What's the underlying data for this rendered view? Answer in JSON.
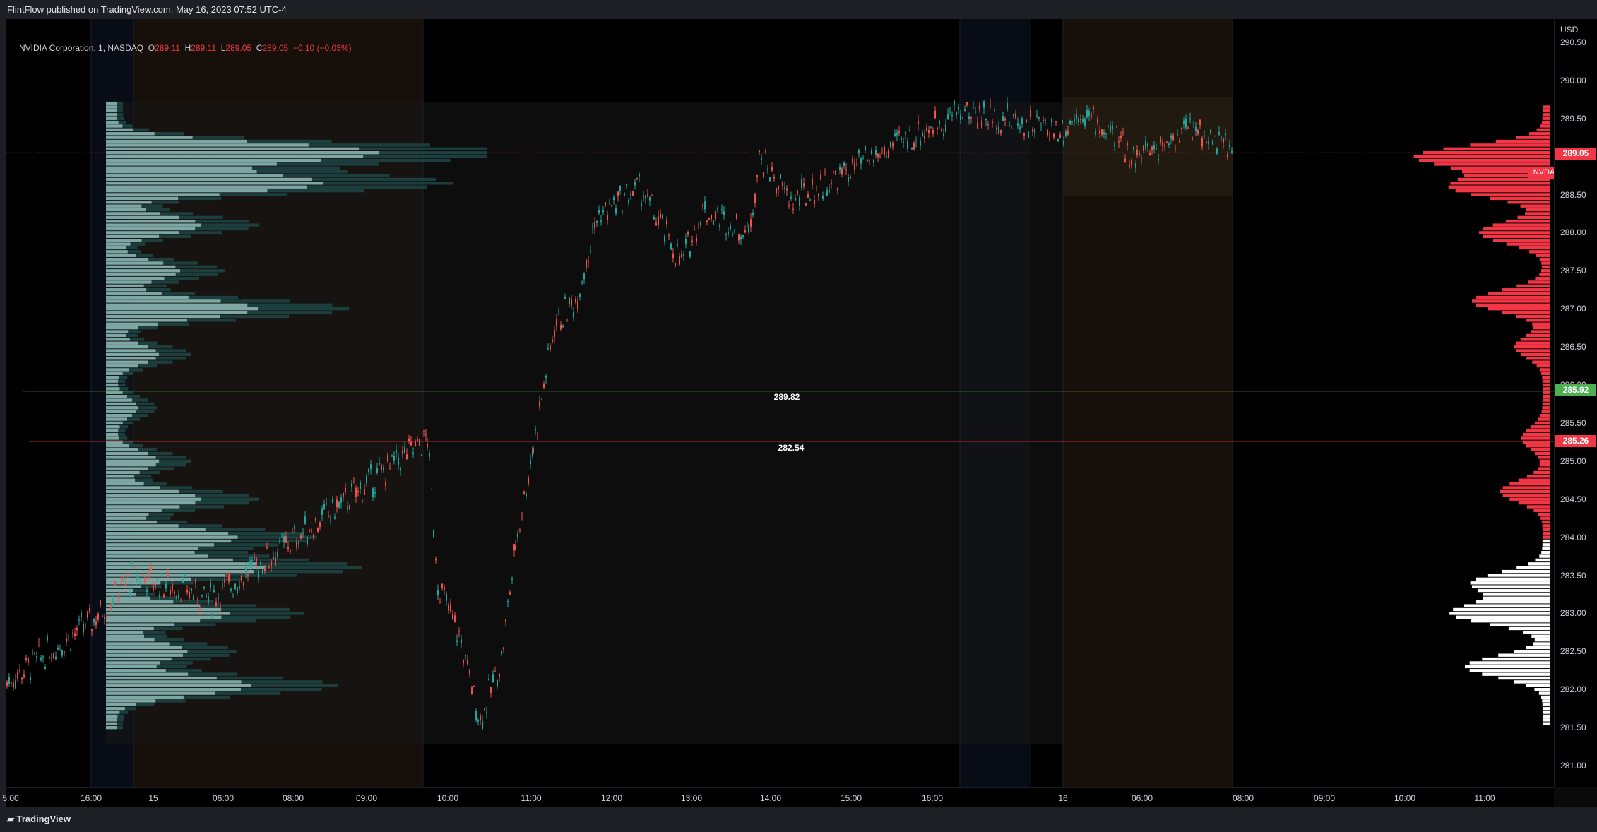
{
  "header": {
    "published": "FlintFlow published on TradingView.com, May 16, 2023 07:52 UTC-4"
  },
  "legend": {
    "symbol": "NVIDIA Corporation, 1, NASDAQ",
    "o_label": "O",
    "o": "289.11",
    "h_label": "H",
    "h": "289.11",
    "l_label": "L",
    "l": "289.05",
    "c_label": "C",
    "c": "289.05",
    "change": "−0.10 (−0.03%)"
  },
  "price_axis": {
    "currency": "USD",
    "ticks": [
      "290.50",
      "290.00",
      "289.50",
      "289.00",
      "288.50",
      "288.00",
      "287.50",
      "287.00",
      "286.50",
      "286.00",
      "285.50",
      "285.00",
      "284.50",
      "284.00",
      "283.50",
      "283.00",
      "282.50",
      "282.00",
      "281.50",
      "281.00"
    ],
    "last_price": "289.05",
    "last_symbol": "NVDA",
    "level_green": "285.92",
    "level_red": "285.26"
  },
  "time_axis": {
    "ticks": [
      "5:00",
      "16:00",
      "15",
      "06:00",
      "08:00",
      "09:00",
      "10:00",
      "11:00",
      "12:00",
      "13:00",
      "14:00",
      "15:00",
      "16:00",
      "16",
      "06:00",
      "08:00",
      "09:00",
      "10:00",
      "11:00"
    ]
  },
  "chart_labels": {
    "green_line_value": "289.82",
    "red_line_value": "282.54"
  },
  "footer": {
    "brand": "TradingView"
  },
  "colors": {
    "up": "#26a69a",
    "down": "#ef5350",
    "profile_light": "#8fb8b4",
    "profile_dark": "#1f4f4d",
    "right_profile_red": "#f23645",
    "right_profile_white": "#ffffff",
    "green_line": "#4caf50",
    "red_line": "#f23645",
    "premarket": "#2a1e12",
    "afterhours": "#0f1726"
  },
  "chart_data": {
    "type": "candlestick",
    "symbol": "NVDA",
    "timeframe": "1",
    "ylim": [
      280.8,
      290.7
    ],
    "last_close": 289.05,
    "horizontal_levels": [
      {
        "price": 285.92,
        "color": "green",
        "label": "289.82"
      },
      {
        "price": 285.26,
        "color": "red",
        "label": "282.54"
      }
    ],
    "price_path_approx": [
      {
        "t": "15 04:00",
        "p": 282.1
      },
      {
        "t": "15 05:00",
        "p": 282.9
      },
      {
        "t": "15 06:00",
        "p": 283.5
      },
      {
        "t": "15 07:00",
        "p": 283.2
      },
      {
        "t": "15 08:00",
        "p": 284.2
      },
      {
        "t": "15 09:30",
        "p": 285.3
      },
      {
        "t": "15 09:40",
        "p": 283.4
      },
      {
        "t": "15 10:00",
        "p": 282.7
      },
      {
        "t": "15 10:20",
        "p": 281.6
      },
      {
        "t": "15 10:40",
        "p": 282.4
      },
      {
        "t": "15 11:00",
        "p": 283.9
      },
      {
        "t": "15 11:20",
        "p": 285.2
      },
      {
        "t": "15 11:40",
        "p": 286.8
      },
      {
        "t": "15 12:00",
        "p": 287.1
      },
      {
        "t": "15 12:20",
        "p": 288.2
      },
      {
        "t": "15 13:00",
        "p": 288.6
      },
      {
        "t": "15 13:40",
        "p": 287.6
      },
      {
        "t": "15 14:00",
        "p": 288.3
      },
      {
        "t": "15 14:40",
        "p": 288.0
      },
      {
        "t": "15 15:00",
        "p": 289.0
      },
      {
        "t": "15 15:30",
        "p": 288.4
      },
      {
        "t": "15 16:00",
        "p": 289.6
      },
      {
        "t": "15 20:00",
        "p": 289.35
      },
      {
        "t": "16 04:00",
        "p": 289.6
      },
      {
        "t": "16 06:00",
        "p": 289.0
      },
      {
        "t": "16 07:00",
        "p": 289.4
      },
      {
        "t": "16 07:52",
        "p": 289.05
      }
    ]
  }
}
